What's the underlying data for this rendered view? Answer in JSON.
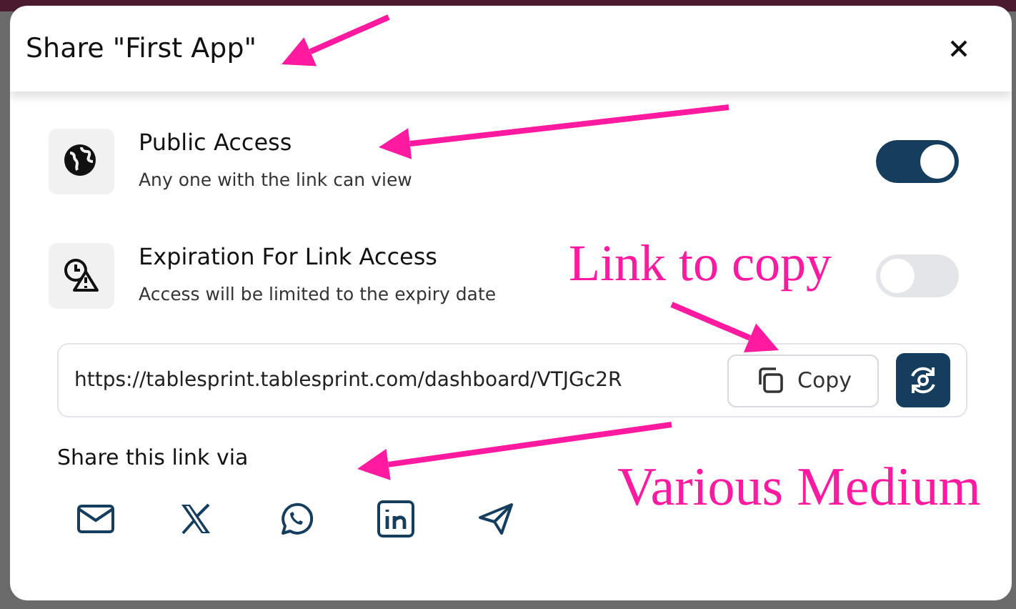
{
  "dialog": {
    "title": "Share \"First App\""
  },
  "settings": [
    {
      "title": "Public Access",
      "description": "Any one with the link can view",
      "on": true
    },
    {
      "title": "Expiration For Link Access",
      "description": "Access will be limited to the expiry date",
      "on": false
    }
  ],
  "link": {
    "url": "https://tablesprint.tablesprint.com/dashboard/VTJGc2R",
    "copy_label": "Copy"
  },
  "share": {
    "heading": "Share this link via"
  },
  "annotations": [
    {
      "text": "Link to copy"
    },
    {
      "text": "Various Medium"
    }
  ]
}
